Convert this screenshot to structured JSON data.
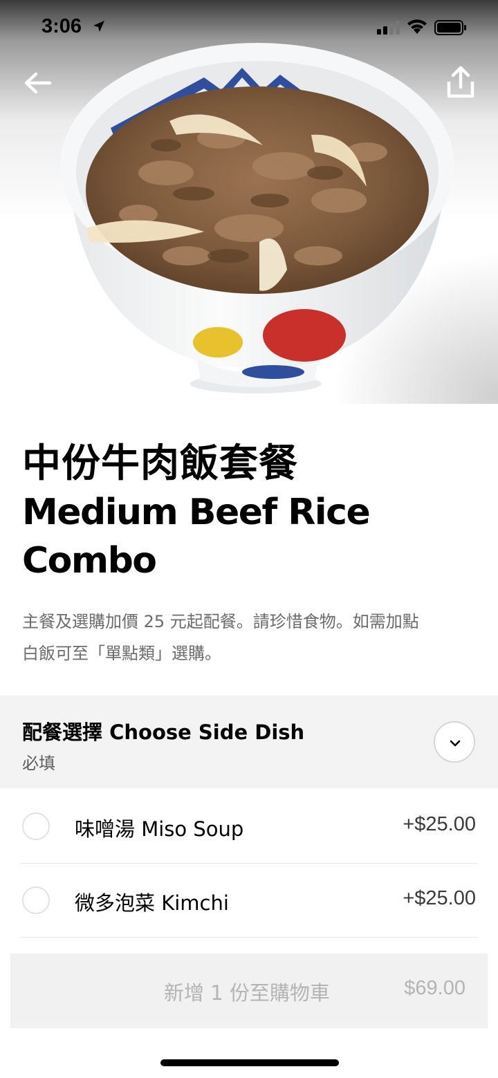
{
  "status_bar": {
    "time": "3:06"
  },
  "icons": {
    "location": "location-arrow-icon",
    "signal": "cellular-signal-icon",
    "wifi": "wifi-icon",
    "battery": "battery-icon",
    "back": "arrow-left-icon",
    "share": "share-icon",
    "expand": "chevron-down-icon"
  },
  "item": {
    "title_zh": "中份牛肉飯套餐",
    "title_en_line1": "Medium Beef Rice",
    "title_en_line2": "Combo",
    "description_line1": "主餐及選購加價 25 元起配餐。請珍惜食物。如需加點",
    "description_line2": "白飯可至「單點類」選購。"
  },
  "options_section": {
    "title": "配餐選擇 Choose Side Dish",
    "required_label": "必填",
    "options": [
      {
        "label": "味噌湯 Miso Soup",
        "price": "+$25.00"
      },
      {
        "label": "微多泡菜 Kimchi",
        "price": "+$25.00"
      }
    ]
  },
  "cart_button": {
    "label": "新增 1 份至購物車",
    "price": "$69.00"
  },
  "colors": {
    "primary_text": "#000000",
    "secondary_text": "#6b6b6b",
    "section_bg": "#f3f3f3",
    "disabled_button_bg": "#f1f1f1",
    "disabled_button_text": "#b4b4b4"
  }
}
